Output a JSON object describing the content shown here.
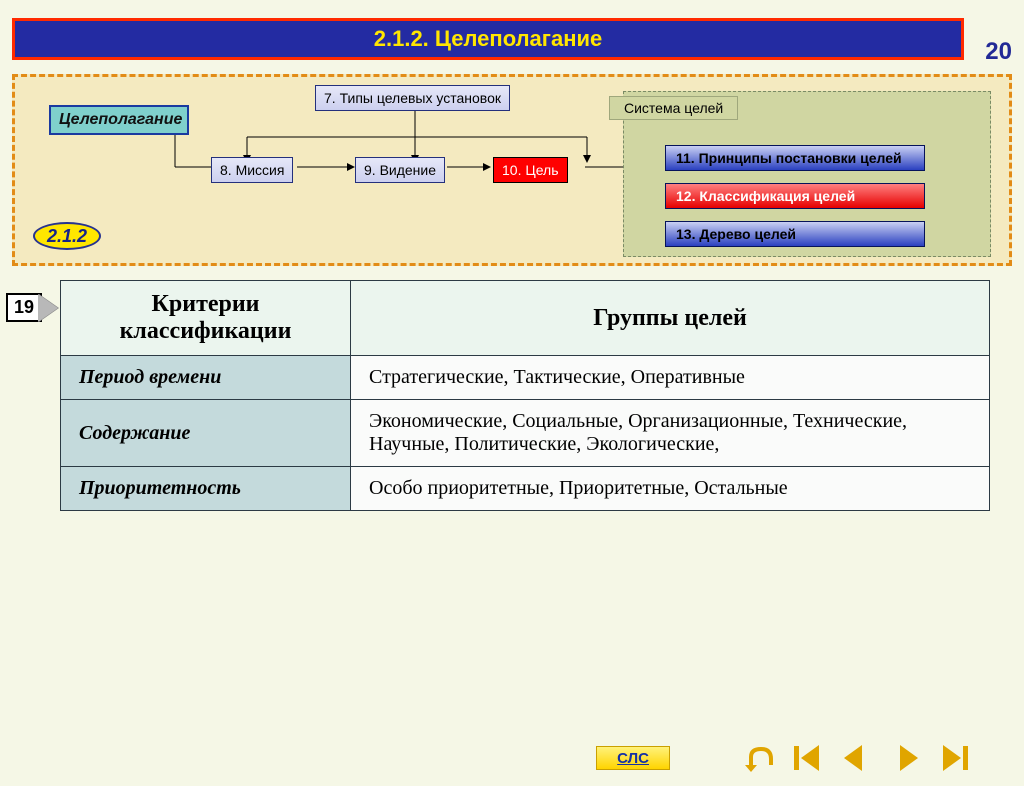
{
  "header": {
    "title": "2.1.2. Целеполагание"
  },
  "page_number_top": "20",
  "diagram": {
    "root": "Целеполагание",
    "top_node": "7. Типы целевых установок",
    "row": {
      "mission": "8. Миссия",
      "vision": "9. Видение",
      "goal": "10. Цель"
    },
    "system_label": "Система целей",
    "system_items": {
      "principles": "11. Принципы постановки целей",
      "classification": "12. Классификация целей",
      "tree": "13. Дерево целей"
    },
    "section_badge": "2.1.2"
  },
  "prev_page_badge": "19",
  "table": {
    "headers": {
      "criteria": "Критерии классификации",
      "groups": "Группы целей"
    },
    "rows": [
      {
        "criterion": "Период времени",
        "groups": "Стратегические, Тактические, Оперативные"
      },
      {
        "criterion": "Содержание",
        "groups": "Экономические, Социальные, Организационные, Технические, Научные, Политические, Экологические,"
      },
      {
        "criterion": "Приоритетность",
        "groups": "Особо приоритетные, Приоритетные, Остальные"
      }
    ]
  },
  "footer": {
    "sls_label": "СЛС"
  }
}
